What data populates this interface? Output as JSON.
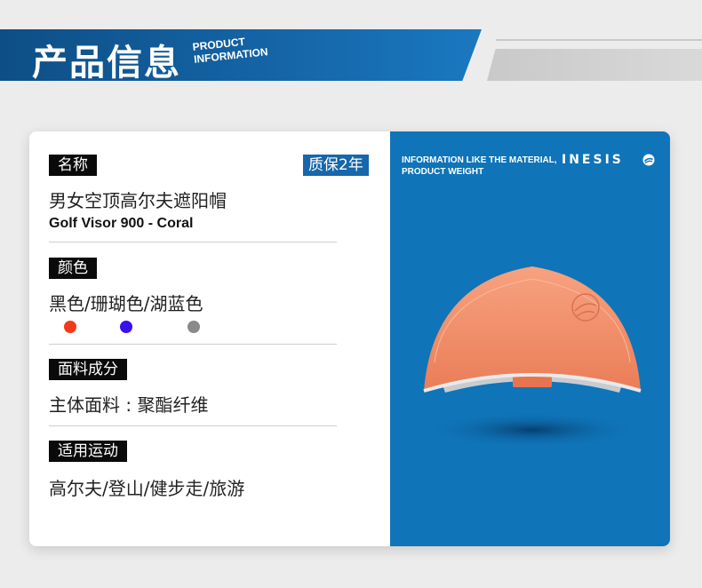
{
  "header": {
    "title": "产品信息",
    "subtitle_line1": "PRODUCT",
    "subtitle_line2": "INFORMATION"
  },
  "card": {
    "name_tag": "名称",
    "warranty_badge": "质保2年",
    "product_name_cn": "男女空顶高尔夫遮阳帽",
    "product_name_en": "Golf Visor 900 - Coral",
    "color_tag": "颜色",
    "colors_text": "黑色/珊瑚色/湖蓝色",
    "color_dots": [
      "#f13a18",
      "#3a10ee",
      "#8a8a8a"
    ],
    "material_tag": "面料成分",
    "material_text": "主体面料 : 聚酯纤维",
    "sport_tag": "适用运动",
    "sport_text": "高尔夫/登山/健步走/旅游"
  },
  "panel": {
    "info_line1": "INFORMATION LIKE THE MATERIAL,",
    "info_line2": "PRODUCT WEIGHT",
    "brand": "INESIS",
    "brand_icon": "inesis-logo-icon",
    "background_color": "#0f74b8",
    "visor_color": "#f6926f"
  }
}
